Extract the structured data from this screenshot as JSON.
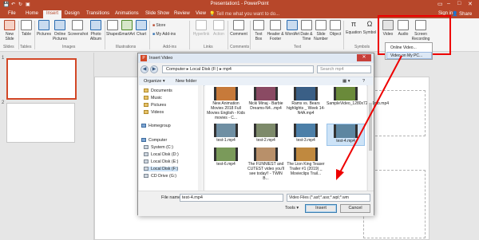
{
  "window": {
    "title": "Presentation1 - PowerPoint",
    "sign_in": "Sign in",
    "share": "Share"
  },
  "tabs": [
    "File",
    "Home",
    "Insert",
    "Design",
    "Transitions",
    "Animations",
    "Slide Show",
    "Review",
    "View"
  ],
  "tell_me": "Tell me what you want to do...",
  "ribbon": {
    "buttons": {
      "new_slide": "New Slide",
      "table": "Table",
      "pictures": "Pictures",
      "online_pictures": "Online Pictures",
      "screenshot": "Screenshot",
      "photo_album": "Photo Album",
      "shapes": "Shapes",
      "smartart": "SmartArt",
      "chart": "Chart",
      "store": "Store",
      "my_addins": "My Add-ins",
      "hyperlink": "Hyperlink",
      "action": "Action",
      "comment": "Comment",
      "text_box": "Text Box",
      "header_footer": "Header & Footer",
      "wordart": "WordArt",
      "date_time": "Date & Time",
      "slide_number": "Slide Number",
      "object": "Object",
      "equation": "Equation",
      "symbol": "Symbol",
      "video": "Video",
      "audio": "Audio",
      "screen_recording": "Screen Recording"
    },
    "groups": {
      "slides": "Slides",
      "tables": "Tables",
      "images": "Images",
      "illustrations": "Illustrations",
      "addins": "Add-ins",
      "links": "Links",
      "comments": "Comments",
      "text": "Text",
      "symbols": "Symbols"
    }
  },
  "video_dropdown": {
    "items": [
      "Online Video...",
      "Video on My PC..."
    ],
    "highlighted_index": 1
  },
  "slides_pane": {
    "numbers": [
      "1",
      "2"
    ]
  },
  "dialog": {
    "title": "Insert Video",
    "close": "✕",
    "address": "Computer ▸ Local Disk (F:) ▸ mp4",
    "search_placeholder": "Search mp4",
    "organize": "Organize ▾",
    "new_folder": "New folder",
    "nav_items": [
      {
        "label": "Documents",
        "icon": "folder"
      },
      {
        "label": "Music",
        "icon": "folder"
      },
      {
        "label": "Pictures",
        "icon": "folder"
      },
      {
        "label": "Videos",
        "icon": "folder"
      },
      {
        "label": "Homegroup",
        "icon": "homegroup"
      },
      {
        "label": "Computer",
        "icon": "computer"
      },
      {
        "label": "System (C:)",
        "icon": "drive"
      },
      {
        "label": "Local Disk (D:)",
        "icon": "drive"
      },
      {
        "label": "Local Disk (E:)",
        "icon": "drive"
      },
      {
        "label": "Local Disk (F:)",
        "icon": "drive",
        "selected": true
      },
      {
        "label": "CD Drive (G:)",
        "icon": "drive"
      }
    ],
    "files": [
      {
        "name": "New Animation Movies 2018 Full Movies English - Kids movies - C...",
        "thumb": "#c77a3a"
      },
      {
        "name": "Nicki Minaj - Barbie Dreams-N4...mp4",
        "thumb": "#8a4a63"
      },
      {
        "name": "Rams vs. Bears highlights _ Week 14-N4A.mp4",
        "thumb": "#3a5f86"
      },
      {
        "name": "SampleVideo_1280x720_1mb.mp4",
        "thumb": "#6a8a3a"
      },
      {
        "name": "test-1.mp4",
        "thumb": "#6f8fa3"
      },
      {
        "name": "test-2.mp4",
        "thumb": "#7d8a6a"
      },
      {
        "name": "test-3.mp4",
        "thumb": "#4c7fa8"
      },
      {
        "name": "test-4.mp4",
        "thumb": "#5d86a1",
        "selected": true
      },
      {
        "name": "test-6.mp4",
        "thumb": "#7a9a5a"
      },
      {
        "name": "The FUNNIEST and CUTEST video you'll see today!! - TWIN B...",
        "thumb": "#b8906a"
      },
      {
        "name": "The Lion King Teaser Trailer #1 (2019) _ Movieclips Trail...",
        "thumb": "#c0893f"
      }
    ],
    "file_name_label": "File name:",
    "file_name": "test-4.mp4",
    "file_type": "Video Files (*.asf;*.asx;*.wpl;*.wm",
    "tools": "Tools ▾",
    "insert": "Insert",
    "cancel": "Cancel"
  },
  "colors": {
    "brand": "#b7472a",
    "highlight_red": "#ee0000"
  }
}
